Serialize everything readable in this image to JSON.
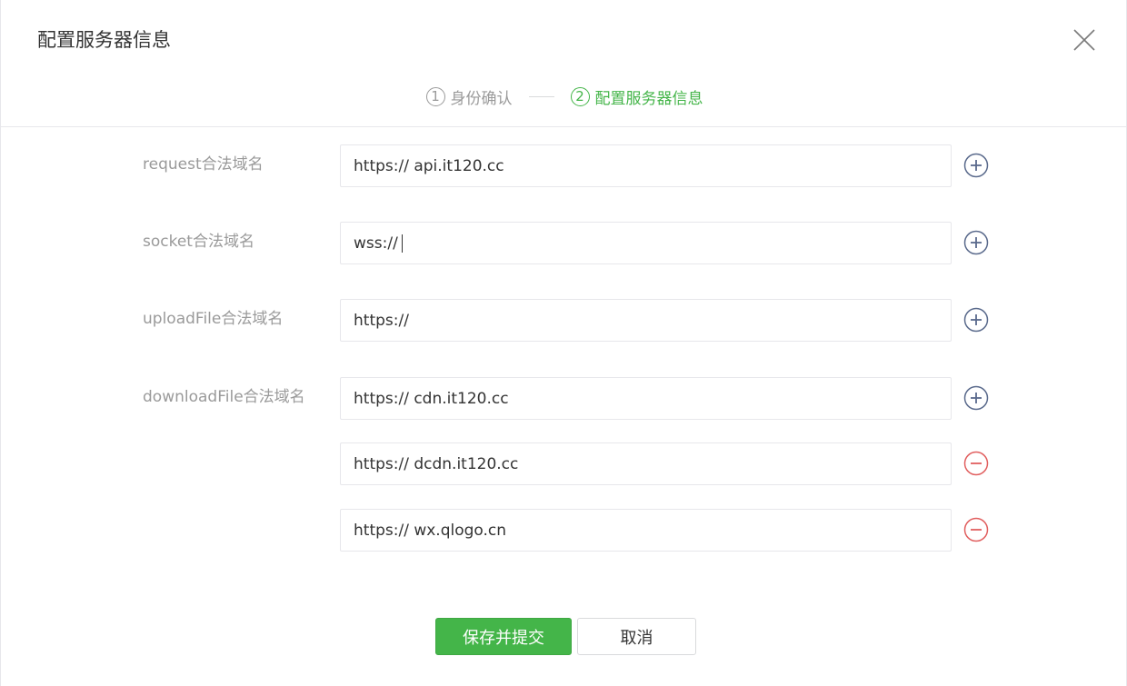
{
  "dialog": {
    "title": "配置服务器信息"
  },
  "steps": [
    {
      "num": "1",
      "label": "身份确认",
      "active": false
    },
    {
      "num": "2",
      "label": "配置服务器信息",
      "active": true
    }
  ],
  "rows": {
    "request": {
      "label": "request合法域名",
      "value": "https:// api.it120.cc",
      "action": "plus-circle-icon"
    },
    "socket": {
      "label": "socket合法域名",
      "value": "wss://",
      "action": "plus-circle-icon"
    },
    "upload": {
      "label": "uploadFile合法域名",
      "value": "https://",
      "action": "plus-circle-icon"
    },
    "download": {
      "label": "downloadFile合法域名",
      "values": [
        "https:// cdn.it120.cc",
        "https:// dcdn.it120.cc",
        "https:// wx.qlogo.cn"
      ],
      "actions": [
        "plus-circle-icon",
        "minus-circle-icon",
        "minus-circle-icon"
      ]
    }
  },
  "buttons": {
    "save": "保存并提交",
    "cancel": "取消"
  },
  "colors": {
    "accent": "#44b549",
    "add_icon": "#5a6a8c",
    "remove_icon": "#e15f5f"
  }
}
